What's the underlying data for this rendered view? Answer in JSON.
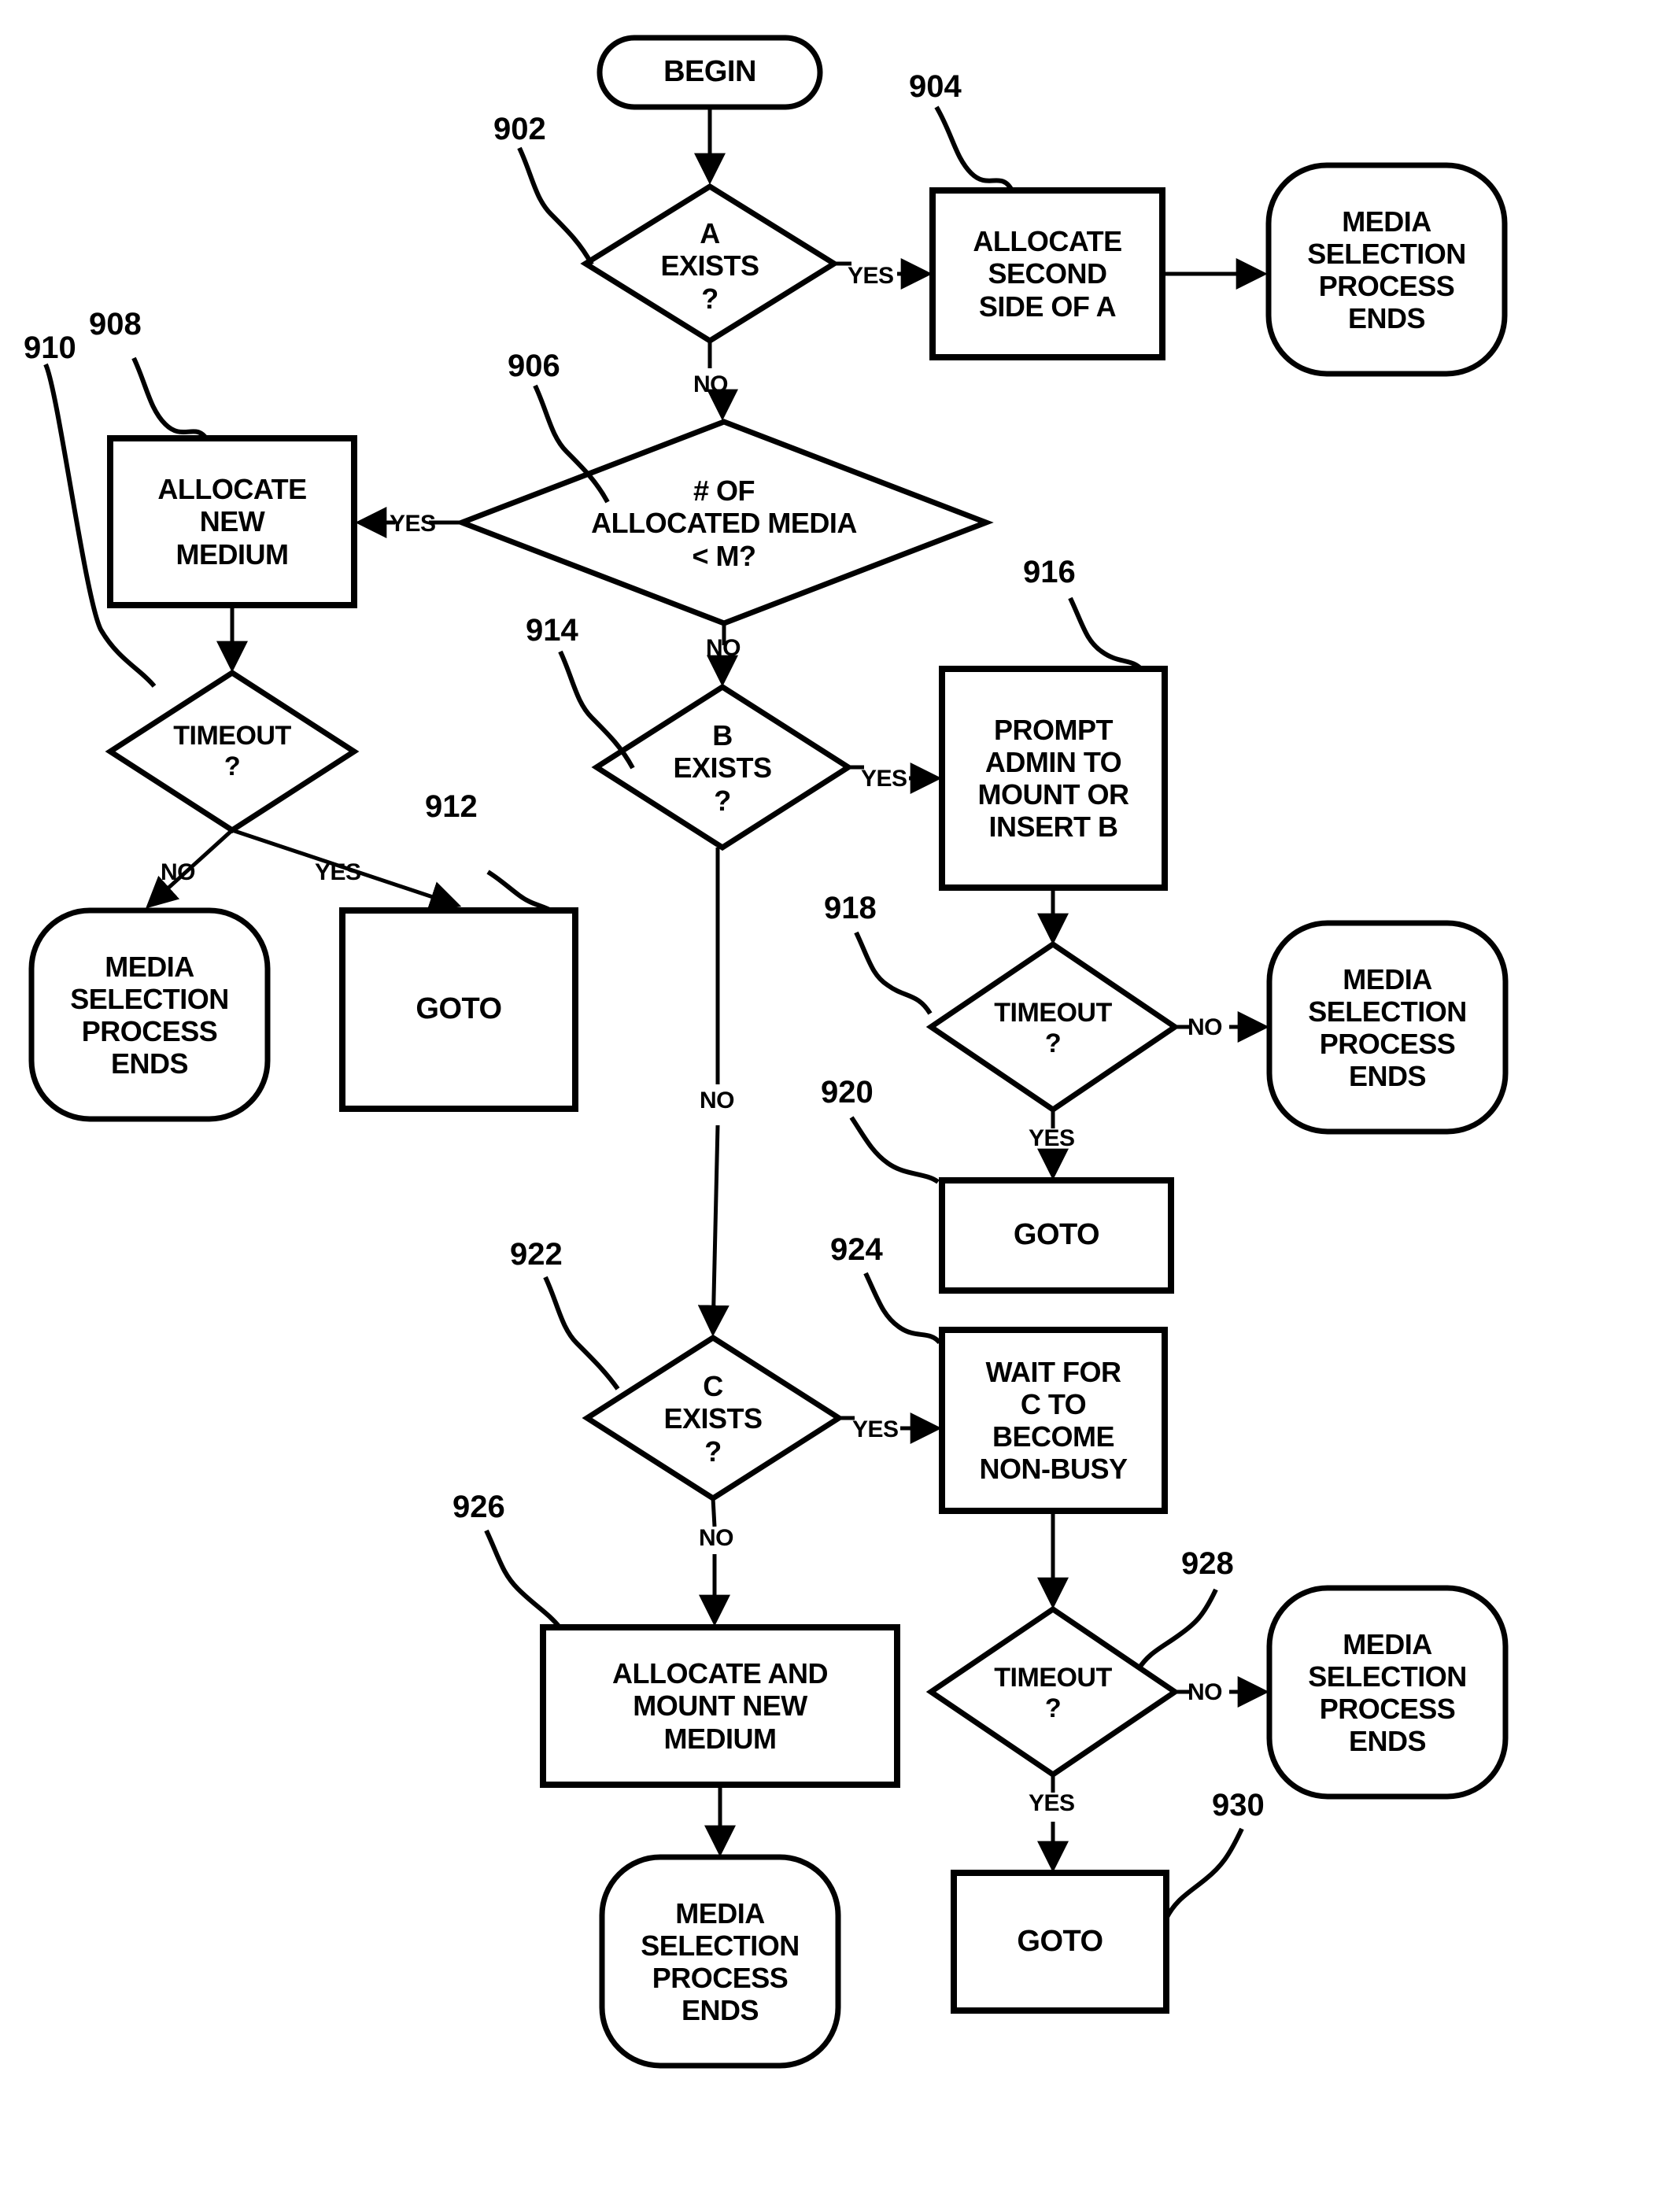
{
  "figure": {
    "type": "patent-flowchart",
    "title": "Media Selection Process Flowchart"
  },
  "nodes": {
    "begin": {
      "label": "BEGIN",
      "shape": "terminator"
    },
    "a_exists": {
      "label": "A\nEXISTS\n?",
      "shape": "decision"
    },
    "allocate_second_side": {
      "label": "ALLOCATE\nSECOND\nSIDE OF A",
      "shape": "process"
    },
    "end_top_right": {
      "label": "MEDIA\nSELECTION\nPROCESS\nENDS",
      "shape": "terminator"
    },
    "num_allocated": {
      "label": "# OF\nALLOCATED MEDIA\n< M?",
      "shape": "decision"
    },
    "allocate_new_medium": {
      "label": "ALLOCATE\nNEW\nMEDIUM",
      "shape": "process"
    },
    "timeout_910": {
      "label": "TIMEOUT\n?",
      "shape": "decision"
    },
    "end_left": {
      "label": "MEDIA\nSELECTION\nPROCESS\nENDS",
      "shape": "terminator"
    },
    "goto_912": {
      "label": "GOTO",
      "shape": "process"
    },
    "b_exists": {
      "label": "B\nEXISTS\n?",
      "shape": "decision"
    },
    "prompt_admin": {
      "label": "PROMPT\nADMIN TO\nMOUNT OR\nINSERT B",
      "shape": "process"
    },
    "timeout_918": {
      "label": "TIMEOUT\n?",
      "shape": "decision"
    },
    "end_mid_right": {
      "label": "MEDIA\nSELECTION\nPROCESS\nENDS",
      "shape": "terminator"
    },
    "goto_920": {
      "label": "GOTO",
      "shape": "process"
    },
    "c_exists": {
      "label": "C\nEXISTS\n?",
      "shape": "decision"
    },
    "wait_for_c": {
      "label": "WAIT FOR\nC TO\nBECOME\nNON-BUSY",
      "shape": "process"
    },
    "timeout_928": {
      "label": "TIMEOUT\n?",
      "shape": "decision"
    },
    "end_bottom_right": {
      "label": "MEDIA\nSELECTION\nPROCESS\nENDS",
      "shape": "terminator"
    },
    "goto_930": {
      "label": "GOTO",
      "shape": "process"
    },
    "allocate_mount_new": {
      "label": "ALLOCATE AND\nMOUNT NEW\nMEDIUM",
      "shape": "process"
    },
    "end_bottom": {
      "label": "MEDIA\nSELECTION\nPROCESS\nENDS",
      "shape": "terminator"
    }
  },
  "edge_labels": {
    "a_yes": "YES",
    "a_no": "NO",
    "alloc_yes": "YES",
    "alloc_no": "NO",
    "timeout910_no": "NO",
    "timeout910_yes": "YES",
    "b_yes": "YES",
    "b_no": "NO",
    "timeout918_no": "NO",
    "timeout918_yes": "YES",
    "c_yes": "YES",
    "c_no": "NO",
    "timeout928_no": "NO",
    "timeout928_yes": "YES"
  },
  "reference_numerals": {
    "n902": "902",
    "n904": "904",
    "n906": "906",
    "n908": "908",
    "n910": "910",
    "n912": "912",
    "n914": "914",
    "n916": "916",
    "n918": "918",
    "n920": "920",
    "n922": "922",
    "n924": "924",
    "n926": "926",
    "n928": "928",
    "n930": "930"
  },
  "colors": {
    "stroke": "#000000",
    "fill": "#ffffff",
    "background": "#ffffff"
  }
}
